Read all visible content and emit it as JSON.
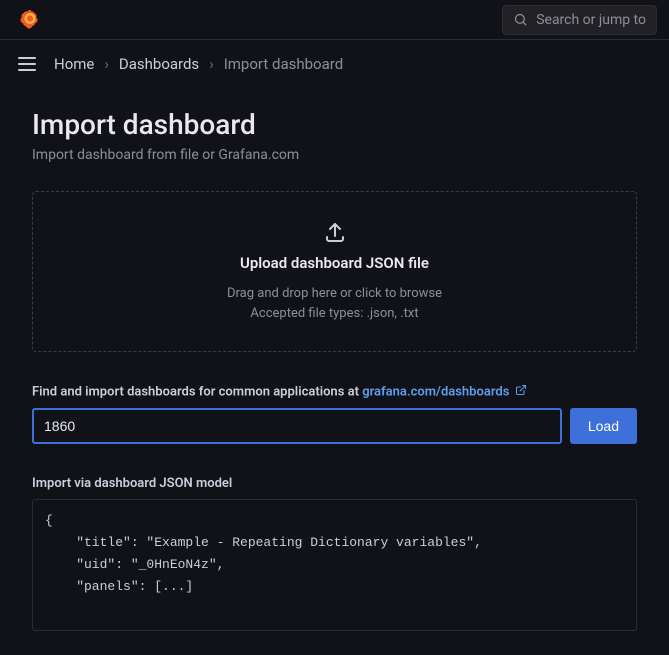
{
  "topbar": {
    "search_placeholder": "Search or jump to"
  },
  "breadcrumb": {
    "home": "Home",
    "dashboards": "Dashboards",
    "current": "Import dashboard"
  },
  "page": {
    "title": "Import dashboard",
    "subtitle": "Import dashboard from file or Grafana.com"
  },
  "upload": {
    "title": "Upload dashboard JSON file",
    "hint_line1": "Drag and drop here or click to browse",
    "hint_line2": "Accepted file types: .json, .txt"
  },
  "find": {
    "label_prefix": "Find and import dashboards for common applications at ",
    "link_text": "grafana.com/dashboards"
  },
  "input": {
    "id_value": "1860",
    "load_label": "Load"
  },
  "json_model": {
    "label": "Import via dashboard JSON model",
    "content": "{\n    \"title\": \"Example - Repeating Dictionary variables\",\n    \"uid\": \"_0HnEoN4z\",\n    \"panels\": [...]"
  }
}
